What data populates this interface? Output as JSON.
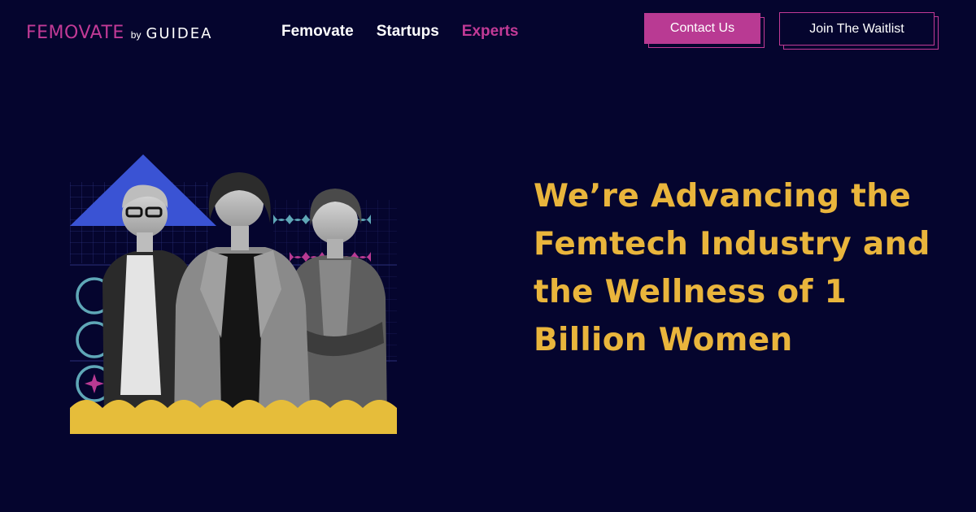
{
  "brand": {
    "name": "FEMOVATE",
    "by": "by",
    "parent": "GUIDEA"
  },
  "nav": [
    {
      "label": "Femovate",
      "active": false
    },
    {
      "label": "Startups",
      "active": false
    },
    {
      "label": "Experts",
      "active": true
    }
  ],
  "header_buttons": {
    "contact": "Contact Us",
    "waitlist": "Join The Waitlist"
  },
  "hero": {
    "headline": "We’re Advancing the Femtech Industry and the Wellness of 1 Billion Women"
  },
  "colors": {
    "background": "#05052e",
    "brand_magenta": "#c23a96",
    "headline_yellow": "#e9b53c",
    "art_blue": "#3a53d4",
    "art_teal": "#5fa7b7",
    "art_yellow": "#e6bd3a"
  }
}
